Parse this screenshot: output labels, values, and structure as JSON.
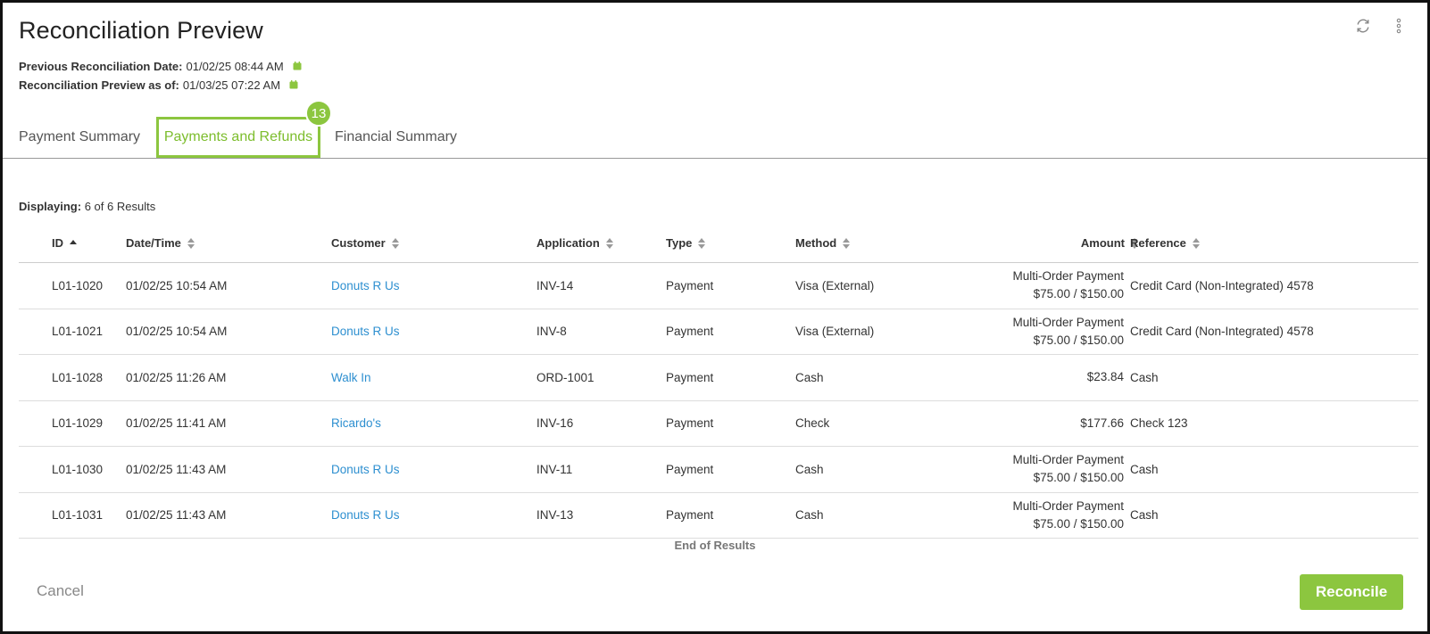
{
  "header": {
    "title": "Reconciliation Preview",
    "prev_label": "Previous Reconciliation Date:",
    "prev_value": "01/02/25 08:44 AM",
    "asof_label": "Reconciliation Preview as of:",
    "asof_value": "01/03/25 07:22 AM"
  },
  "tabs": [
    {
      "label": "Payment Summary"
    },
    {
      "label": "Payments and Refunds"
    },
    {
      "label": "Financial Summary"
    }
  ],
  "step_badge": "13",
  "results": {
    "label": "Displaying:",
    "value": "6 of 6 Results",
    "end_text": "End of Results"
  },
  "columns": {
    "id": "ID",
    "date": "Date/Time",
    "customer": "Customer",
    "application": "Application",
    "type": "Type",
    "method": "Method",
    "amount": "Amount",
    "reference": "Reference"
  },
  "rows": [
    {
      "id": "L01-1020",
      "date": "01/02/25 10:54 AM",
      "customer": "Donuts R Us",
      "application": "INV-14",
      "type": "Payment",
      "method": "Visa (External)",
      "amount_line1": "Multi-Order Payment",
      "amount_line2": "$75.00 / $150.00",
      "reference": "Credit Card (Non-Integrated) 4578"
    },
    {
      "id": "L01-1021",
      "date": "01/02/25 10:54 AM",
      "customer": "Donuts R Us",
      "application": "INV-8",
      "type": "Payment",
      "method": "Visa (External)",
      "amount_line1": "Multi-Order Payment",
      "amount_line2": "$75.00 / $150.00",
      "reference": "Credit Card (Non-Integrated) 4578"
    },
    {
      "id": "L01-1028",
      "date": "01/02/25 11:26 AM",
      "customer": "Walk In",
      "application": "ORD-1001",
      "type": "Payment",
      "method": "Cash",
      "amount_line1": "$23.84",
      "amount_line2": "",
      "reference": "Cash"
    },
    {
      "id": "L01-1029",
      "date": "01/02/25 11:41 AM",
      "customer": "Ricardo's",
      "application": "INV-16",
      "type": "Payment",
      "method": "Check",
      "amount_line1": "$177.66",
      "amount_line2": "",
      "reference": "Check 123"
    },
    {
      "id": "L01-1030",
      "date": "01/02/25 11:43 AM",
      "customer": "Donuts R Us",
      "application": "INV-11",
      "type": "Payment",
      "method": "Cash",
      "amount_line1": "Multi-Order Payment",
      "amount_line2": "$75.00 / $150.00",
      "reference": "Cash"
    },
    {
      "id": "L01-1031",
      "date": "01/02/25 11:43 AM",
      "customer": "Donuts R Us",
      "application": "INV-13",
      "type": "Payment",
      "method": "Cash",
      "amount_line1": "Multi-Order Payment",
      "amount_line2": "$75.00 / $150.00",
      "reference": "Cash"
    }
  ],
  "footer": {
    "cancel_label": "Cancel",
    "reconcile_label": "Reconcile"
  },
  "colors": {
    "accent": "#8cc63f",
    "link": "#2d8fd0"
  },
  "icons": {
    "refresh": "refresh-icon",
    "more": "more-vertical-icon",
    "calendar": "calendar-icon",
    "sort": "sort-icon",
    "sort_up": "sort-ascending-icon"
  }
}
